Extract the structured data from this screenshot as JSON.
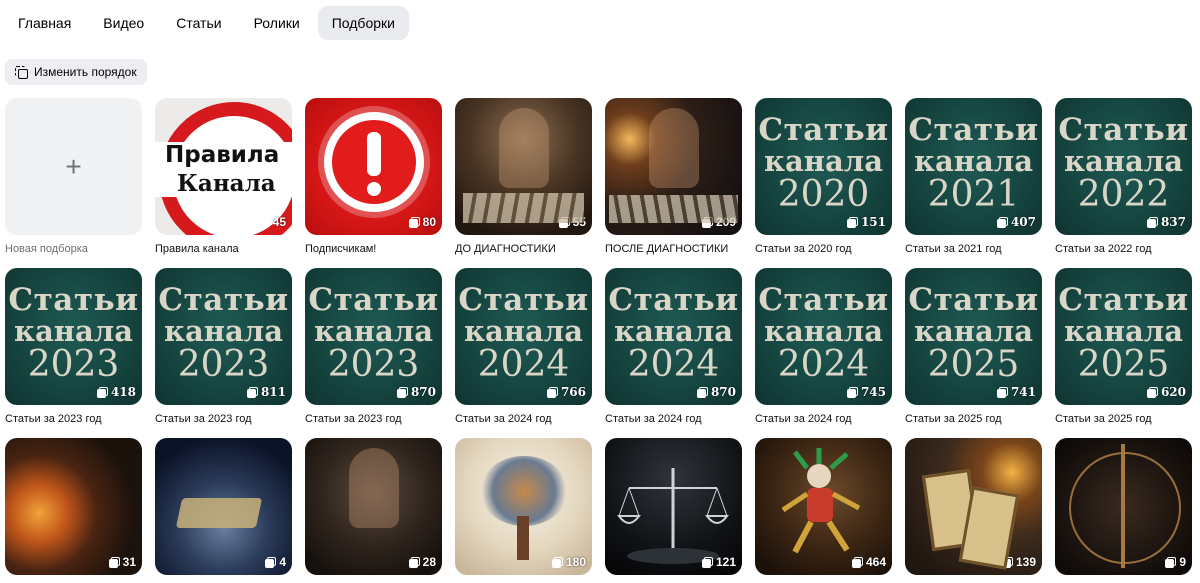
{
  "tabs": [
    {
      "label": "Главная",
      "active": false
    },
    {
      "label": "Видео",
      "active": false
    },
    {
      "label": "Статьи",
      "active": false
    },
    {
      "label": "Ролики",
      "active": false
    },
    {
      "label": "Подборки",
      "active": true
    }
  ],
  "reorder_button": {
    "label": "Изменить порядок",
    "icon": "reorder-icon"
  },
  "new_collection": {
    "label": "Новая подборка",
    "icon": "plus-icon"
  },
  "collections": [
    {
      "title": "Правила канала",
      "count": "45",
      "cover": "rules",
      "cover_text": [
        "Правила",
        "Канала"
      ]
    },
    {
      "title": "Подписчикам!",
      "count": "80",
      "cover": "alert-icon"
    },
    {
      "title": "ДО ДИАГНОСТИКИ",
      "count": "55",
      "cover": "photo"
    },
    {
      "title": "ПОСЛЕ ДИАГНОСТИКИ",
      "count": "209",
      "cover": "photo"
    },
    {
      "title": "Статьи за 2020 год",
      "count": "151",
      "cover": "year",
      "cover_text": [
        "Статьи",
        "канала",
        "2020"
      ]
    },
    {
      "title": "Статьи за 2021 год",
      "count": "407",
      "cover": "year",
      "cover_text": [
        "Статьи",
        "канала",
        "2021"
      ]
    },
    {
      "title": "Статьи за 2022 год",
      "count": "837",
      "cover": "year",
      "cover_text": [
        "Статьи",
        "канала",
        "2022"
      ]
    },
    {
      "title": "Статьи за 2023 год",
      "count": "418",
      "cover": "year",
      "cover_text": [
        "Статьи",
        "канала",
        "2023"
      ]
    },
    {
      "title": "Статьи за 2023 год",
      "count": "811",
      "cover": "year",
      "cover_text": [
        "Статьи",
        "канала",
        "2023"
      ]
    },
    {
      "title": "Статьи за 2023 год",
      "count": "870",
      "cover": "year",
      "cover_text": [
        "Статьи",
        "канала",
        "2023"
      ]
    },
    {
      "title": "Статьи за 2024 год",
      "count": "766",
      "cover": "year",
      "cover_text": [
        "Статьи",
        "канала",
        "2024"
      ]
    },
    {
      "title": "Статьи за 2024 год",
      "count": "870",
      "cover": "year",
      "cover_text": [
        "Статьи",
        "канала",
        "2024"
      ]
    },
    {
      "title": "Статьи за 2024 год",
      "count": "745",
      "cover": "year",
      "cover_text": [
        "Статьи",
        "канала",
        "2024"
      ]
    },
    {
      "title": "Статьи за 2025 год",
      "count": "741",
      "cover": "year",
      "cover_text": [
        "Статьи",
        "канала",
        "2025"
      ]
    },
    {
      "title": "Статьи за 2025 год",
      "count": "620",
      "cover": "year",
      "cover_text": [
        "Статьи",
        "канала",
        "2025"
      ]
    },
    {
      "count": "31",
      "cover": "photo"
    },
    {
      "count": "4",
      "cover": "photo"
    },
    {
      "count": "28",
      "cover": "photo"
    },
    {
      "count": "180",
      "cover": "photo"
    },
    {
      "count": "121",
      "cover": "photo"
    },
    {
      "count": "464",
      "cover": "photo"
    },
    {
      "count": "139",
      "cover": "photo"
    },
    {
      "count": "9",
      "cover": "photo"
    }
  ],
  "colors": {
    "active_tab_bg": "#e9ebee",
    "year_cover": "#164641",
    "alert_red": "#e21b1b"
  }
}
